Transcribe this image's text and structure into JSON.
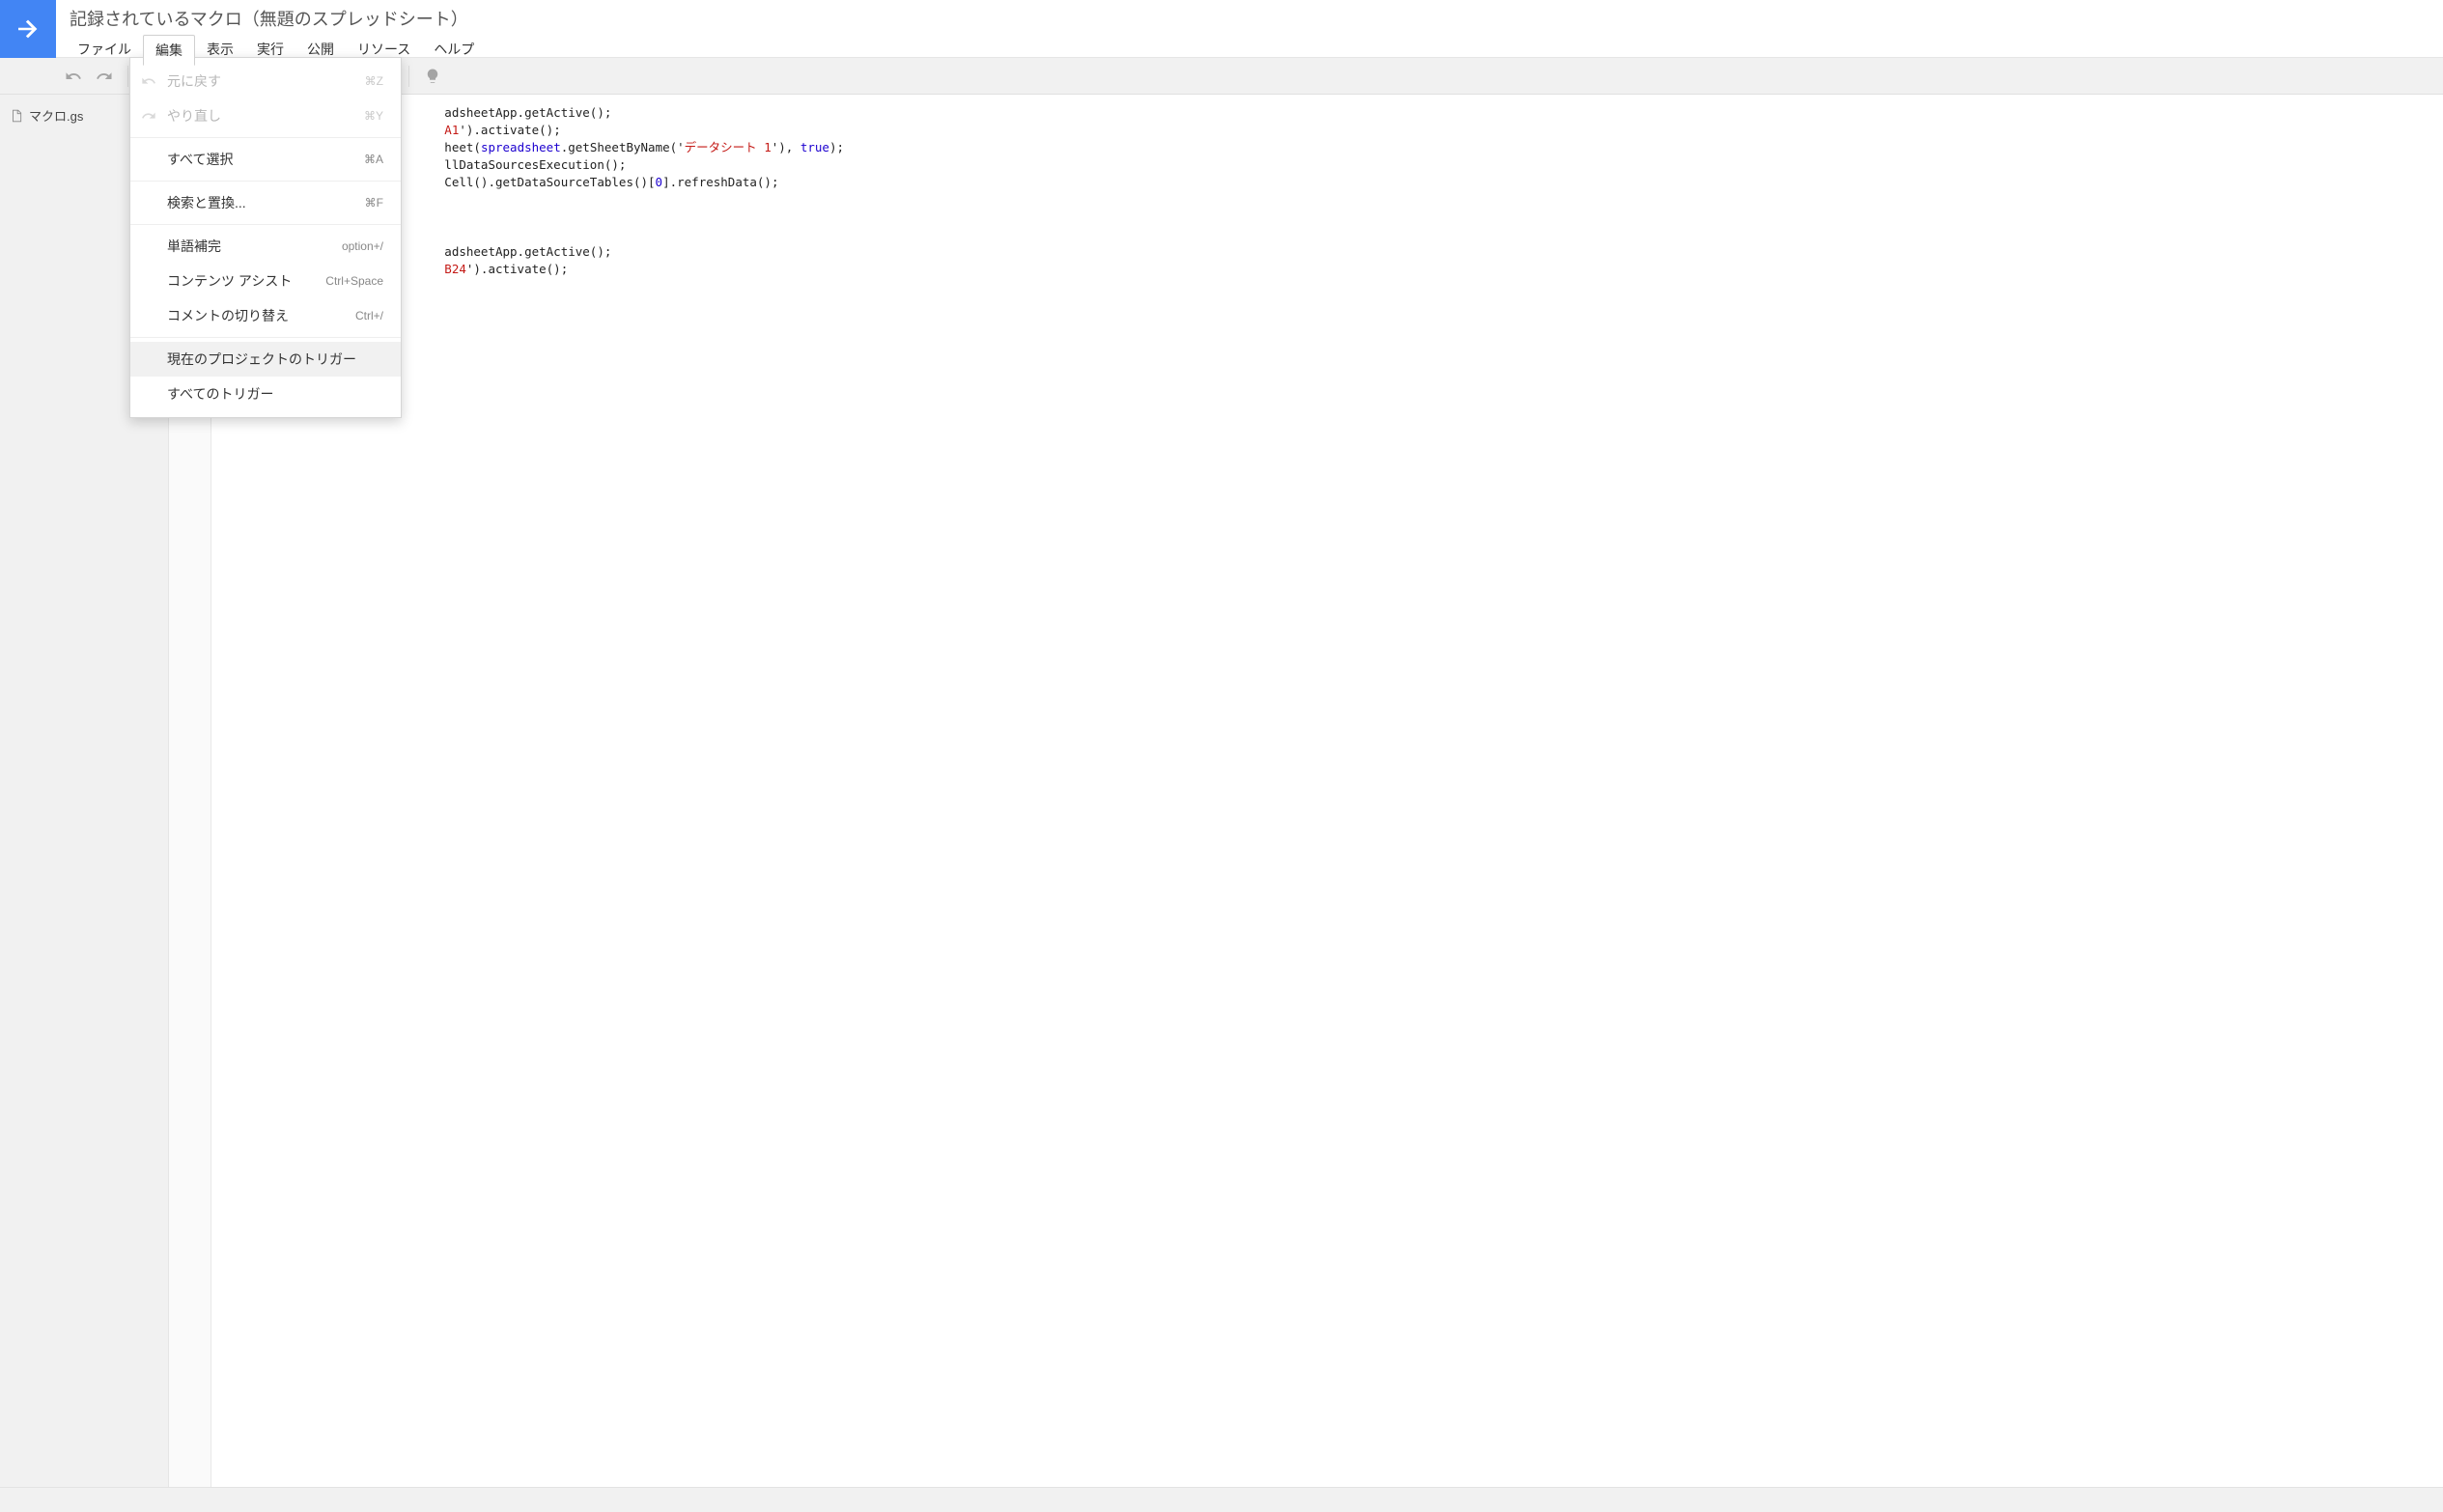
{
  "title": "記録されているマクロ（無題のスプレッドシート）",
  "menu": {
    "file": "ファイル",
    "edit": "編集",
    "view": "表示",
    "run": "実行",
    "publish": "公開",
    "resources": "リソース",
    "help": "ヘルプ"
  },
  "toolbar": {
    "undo": "undo-icon",
    "redo": "redo-icon",
    "bulb": "lightbulb-icon"
  },
  "sidebar": {
    "file_name": "マクロ.gs"
  },
  "dropdown": {
    "undo": {
      "label": "元に戻す",
      "shortcut": "⌘Z"
    },
    "redo": {
      "label": "やり直し",
      "shortcut": "⌘Y"
    },
    "select_all": {
      "label": "すべて選択",
      "shortcut": "⌘A"
    },
    "find_replace": {
      "label": "検索と置換...",
      "shortcut": "⌘F"
    },
    "word_complete": {
      "label": "単語補完",
      "shortcut": "option+/"
    },
    "content_assist": {
      "label": "コンテンツ アシスト",
      "shortcut": "Ctrl+Space"
    },
    "toggle_comment": {
      "label": "コメントの切り替え",
      "shortcut": "Ctrl+/"
    },
    "current_triggers": {
      "label": "現在のプロジェクトのトリガー"
    },
    "all_triggers": {
      "label": "すべてのトリガー"
    }
  },
  "code": {
    "frag1": "adsheetApp.getActive();",
    "a1": "A1",
    "frag2": "').activate();",
    "frag3": "heet(",
    "spreadsheet": "spreadsheet",
    "frag4": ".getSheetByName('",
    "sheet_name": "データシート 1",
    "frag5": "'), ",
    "true": "true",
    "frag6": ");",
    "frag7": "llDataSourcesExecution();",
    "frag8": "Cell().getDataSourceTables()[",
    "zero": "0",
    "frag9": "].refreshData();",
    "frag10": "adsheetApp.getActive();",
    "b24": "B24",
    "frag11": "').activate();"
  }
}
